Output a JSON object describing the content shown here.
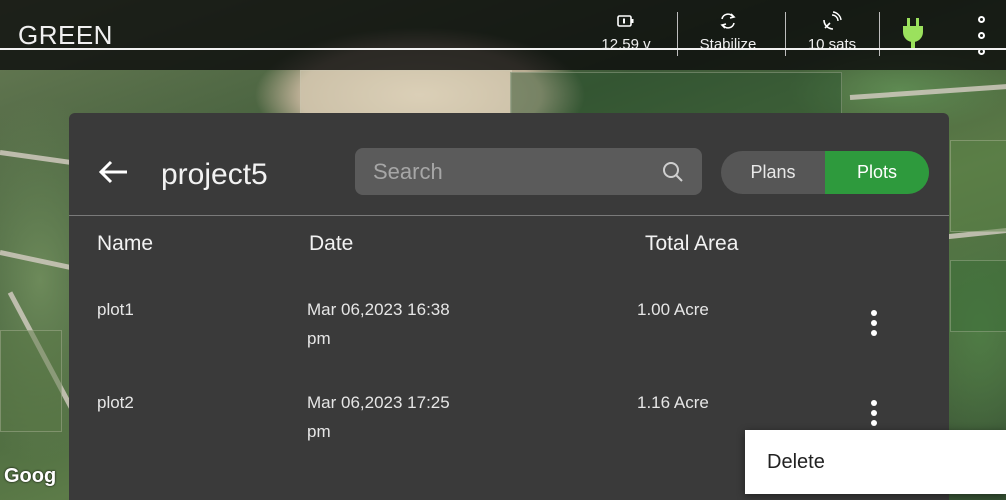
{
  "topbar": {
    "vehicle_name": "GREEN",
    "voltage": "12.59 v",
    "mode": "Stabilize",
    "satellites": "10 sats",
    "icons": [
      "battery-icon",
      "mode-cycle-icon",
      "satellite-icon",
      "plug-icon",
      "more-vertical-icon"
    ],
    "plug_color": "#9be15d"
  },
  "panel": {
    "title": "project5",
    "search": {
      "placeholder": "Search",
      "value": ""
    },
    "toggle": {
      "options": [
        "Plans",
        "Plots"
      ],
      "selected": "Plots",
      "active_color": "#2e9a3d"
    },
    "columns": [
      "Name",
      "Date",
      "Total Area"
    ],
    "rows": [
      {
        "name": "plot1",
        "date_line1": "Mar 06,2023 16:38",
        "date_line2": "pm",
        "area": "1.00 Acre"
      },
      {
        "name": "plot2",
        "date_line1": "Mar 06,2023 17:25",
        "date_line2": "pm",
        "area": "1.16 Acre"
      }
    ]
  },
  "map": {
    "attribution": "Goog"
  },
  "context_menu": {
    "items": [
      "Delete"
    ]
  }
}
